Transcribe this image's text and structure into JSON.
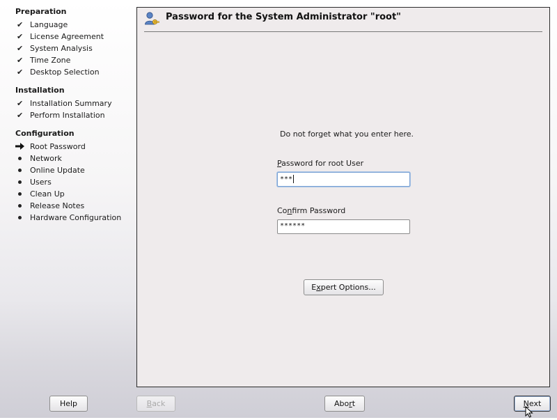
{
  "sidebar": {
    "sections": [
      {
        "title": "Preparation",
        "items": [
          {
            "label": "Language",
            "status": "done"
          },
          {
            "label": "License Agreement",
            "status": "done"
          },
          {
            "label": "System Analysis",
            "status": "done"
          },
          {
            "label": "Time Zone",
            "status": "done"
          },
          {
            "label": "Desktop Selection",
            "status": "done"
          }
        ]
      },
      {
        "title": "Installation",
        "items": [
          {
            "label": "Installation Summary",
            "status": "done"
          },
          {
            "label": "Perform Installation",
            "status": "done"
          }
        ]
      },
      {
        "title": "Configuration",
        "items": [
          {
            "label": "Root Password",
            "status": "current"
          },
          {
            "label": "Network",
            "status": "pending"
          },
          {
            "label": "Online Update",
            "status": "pending"
          },
          {
            "label": "Users",
            "status": "pending"
          },
          {
            "label": "Clean Up",
            "status": "pending"
          },
          {
            "label": "Release Notes",
            "status": "pending"
          },
          {
            "label": "Hardware Configuration",
            "status": "pending"
          }
        ]
      }
    ]
  },
  "main": {
    "title": "Password for the System Administrator \"root\"",
    "hint": "Do not forget what you enter here.",
    "password_label_first": "P",
    "password_label_rest": "assword for root User",
    "password_value": "***",
    "confirm_label_pre": "Co",
    "confirm_label_ul": "n",
    "confirm_label_post": "firm Password",
    "confirm_value": "******",
    "expert_pre": "E",
    "expert_ul": "x",
    "expert_post": "pert Options..."
  },
  "footer": {
    "help_label": "Help",
    "back_label": "Back",
    "back_ul": "B",
    "back_rest": "ack",
    "abort_pre": "Abo",
    "abort_ul": "r",
    "abort_post": "t",
    "next_ul": "N",
    "next_rest": "ext"
  },
  "icons": {
    "title_icon": "user-key-icon",
    "done": "check-icon",
    "current": "arrow-right-icon",
    "pending": "bullet-icon"
  },
  "colors": {
    "panel_bg": "#efebec",
    "focus_ring": "#7ba2d4"
  }
}
